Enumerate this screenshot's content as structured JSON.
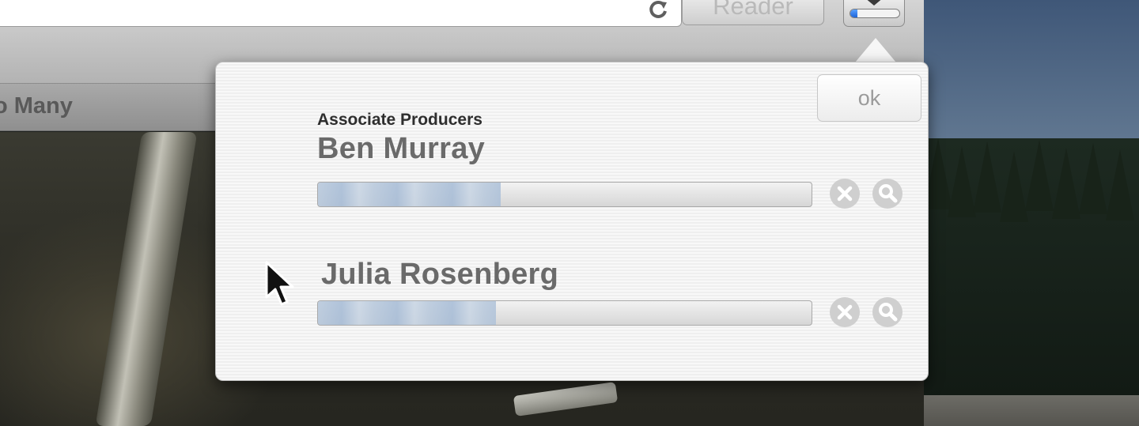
{
  "browser": {
    "reader_label": "Reader",
    "tab_title": "o Many",
    "downloads_indicator_progress": 0.15
  },
  "popover": {
    "ok_label": "ok",
    "downloads": [
      {
        "subtitle": "Associate Producers",
        "name": "Ben Murray",
        "progress": 0.37
      },
      {
        "subtitle": "",
        "name": "Julia Rosenberg",
        "progress": 0.36
      }
    ]
  },
  "colors": {
    "accent_blue": "#1e64d8",
    "progress_fill": "#b7c8dc",
    "button_gray": "#cfcfcf"
  },
  "icons": [
    "reload-icon",
    "download-arrow-icon",
    "stop-icon",
    "magnifier-icon",
    "mouse-cursor-icon"
  ]
}
